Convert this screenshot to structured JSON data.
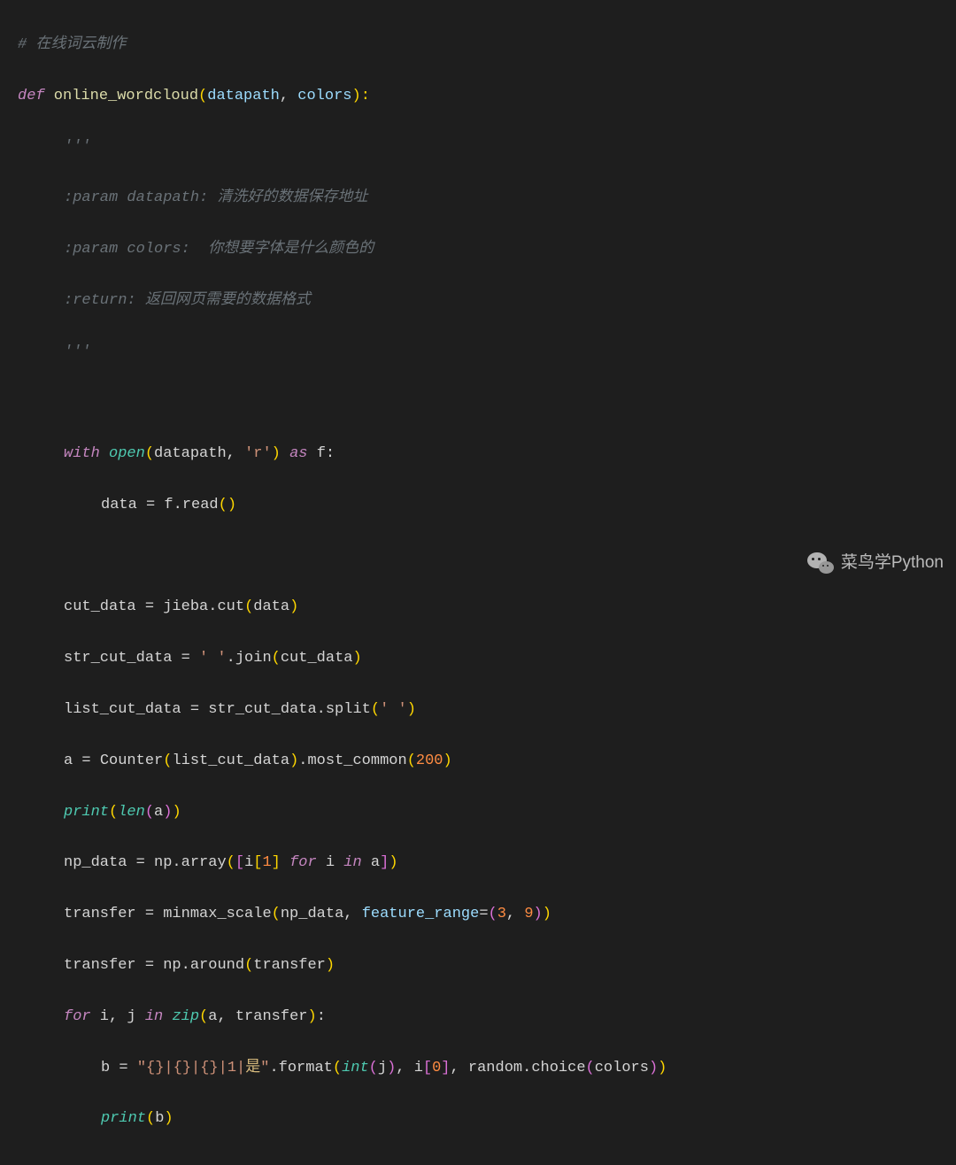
{
  "code": {
    "comment1": "# 在线词云制作",
    "def_kw": "def",
    "func_name": " online_wordcloud",
    "lparen": "(",
    "param1": "datapath",
    "comma": ", ",
    "param2": "colors",
    "rparen_colon": "):",
    "docstring_open": "'''",
    "doc_line1_a": ":param datapath: ",
    "doc_line1_b": "清洗好的数据保存地址",
    "doc_line2_a": ":param colors:  ",
    "doc_line2_b": "你想要字体是什么颜色的",
    "doc_line3_a": ":return: ",
    "doc_line3_b": "返回网页需要的数据格式",
    "docstring_close": "'''",
    "with_kw": "with",
    "open_fn": " open",
    "open_lp": "(",
    "open_arg1": "datapath",
    "open_comma": ", ",
    "open_str": "'r'",
    "open_rp": ")",
    "as_kw": " as ",
    "as_var": "f",
    "as_colon": ":",
    "data_assign": "data ",
    "eq": "= ",
    "f_read": "f.read",
    "cut_data_line": "cut_data ",
    "jieba_cut": "jieba.cut",
    "data_arg": "data",
    "str_cut_line": "str_cut_data ",
    "space_str": "' '",
    "join_call": ".join",
    "cut_data_arg": "cut_data",
    "list_cut_line": "list_cut_data ",
    "str_cut_ref": "str_cut_data.split",
    "split_arg": "' '",
    "a_line": "a ",
    "counter": "Counter",
    "list_cut_arg": "list_cut_data",
    "most_common": ".most_common",
    "num200": "200",
    "print_fn": "print",
    "len_fn": "len",
    "a_arg": "a",
    "np_data_line": "np_data ",
    "np_array": "np.array",
    "i_sub": "i",
    "lbracket": "[",
    "num1": "1",
    "rbracket": "]",
    "for_kw": " for ",
    "in_kw": " in ",
    "transfer_line": "transfer ",
    "minmax": "minmax_scale",
    "np_data_arg": "np_data",
    "feature_range": "feature_range",
    "num3": "3",
    "num9": "9",
    "np_around": "np.around",
    "transfer_arg": "transfer",
    "for2_kw": "for",
    "i_var": " i",
    "j_var": " j ",
    "zip_fn": "zip",
    "a_ref": "a",
    "b_line": "b ",
    "fmt_str": "\"{}|{}|{}|1|",
    "fmt_cjk": "是",
    "fmt_end": "\"",
    "format_call": ".format",
    "int_fn": "int",
    "j_arg": "j",
    "i0": "i",
    "num0": "0",
    "random_choice": "random.choice",
    "colors_arg": "colors",
    "b_ref": "b"
  },
  "watermark": {
    "text": "菜鸟学Python"
  }
}
